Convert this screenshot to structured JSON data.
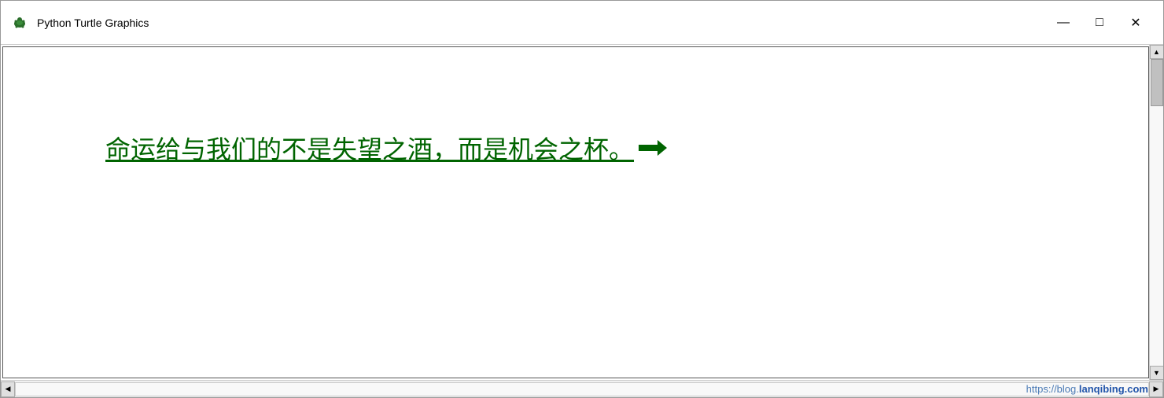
{
  "window": {
    "title": "Python Turtle Graphics",
    "icon": "turtle-icon"
  },
  "titlebar": {
    "minimize_label": "—",
    "maximize_label": "□",
    "close_label": "✕"
  },
  "canvas": {
    "text": "命运给与我们的不是失望之酒，而是机会之杯。",
    "text_color": "#006400"
  },
  "watermark": {
    "prefix": "https://blog.",
    "highlight": "lanqibing.com"
  },
  "scrollbar": {
    "up_arrow": "▲",
    "down_arrow": "▼",
    "left_arrow": "◀",
    "right_arrow": "▶"
  }
}
